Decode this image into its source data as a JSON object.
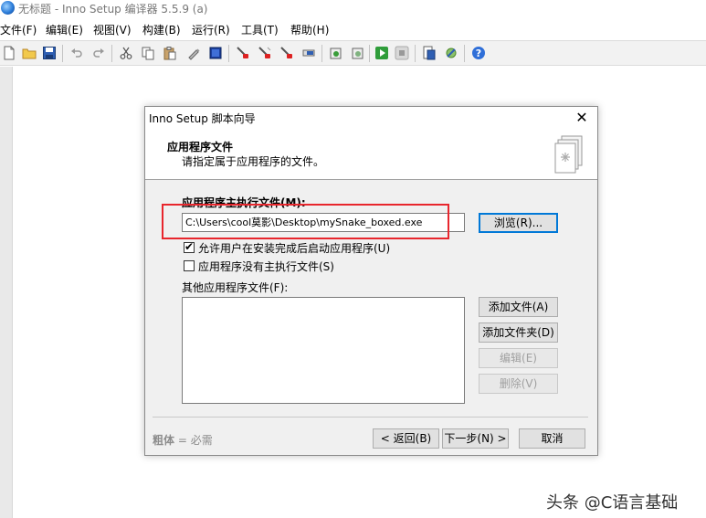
{
  "window": {
    "title": "无标题 - Inno Setup 编译器 5.5.9 (a)"
  },
  "menu": [
    "文件(F)",
    "编辑(E)",
    "视图(V)",
    "构建(B)",
    "运行(R)",
    "工具(T)",
    "帮助(H)"
  ],
  "toolbar_icons": [
    "new-file",
    "open",
    "save",
    "undo",
    "redo",
    "cut",
    "copy",
    "paste",
    "edit",
    "select-all",
    "compile",
    "stop-compile",
    "clean",
    "toggle",
    "run-setup",
    "pause",
    "run",
    "stop",
    "target-file",
    "settings",
    "help"
  ],
  "dialog": {
    "title": "Inno Setup 脚本向导",
    "close": "✕",
    "header_title": "应用程序文件",
    "header_subtitle": "请指定属于应用程序的文件。",
    "main_exe_label": "应用程序主执行文件(M):",
    "main_exe_value": "C:\\Users\\cool莫影\\Desktop\\mySnake_boxed.exe",
    "browse_button": "浏览(R)...",
    "checkbox_allow_launch": {
      "label": "允许用户在安装完成后启动应用程序(U)",
      "checked": true
    },
    "checkbox_no_main_exe": {
      "label": "应用程序没有主执行文件(S)",
      "checked": false
    },
    "other_files_label": "其他应用程序文件(F):",
    "add_files_button": "添加文件(A)",
    "add_folder_button": "添加文件夹(D)",
    "edit_button": "编辑(E)",
    "delete_button": "删除(V)",
    "footer_hint_bold": "粗体",
    "footer_hint_rest": " = 必需",
    "back_button": "< 返回(B)",
    "next_button": "下一步(N) >",
    "cancel_button": "取消"
  },
  "watermark": "头条 @C语言基础",
  "colors": {
    "highlight": "#e8262d",
    "default_button_border": "#0078d7"
  }
}
